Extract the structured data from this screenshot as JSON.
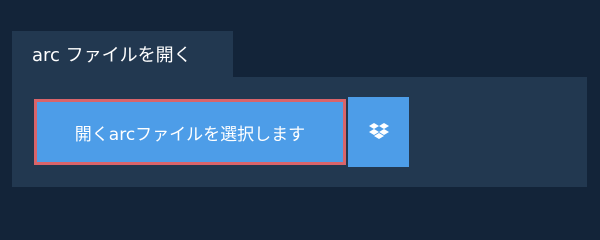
{
  "tab": {
    "label": "arc ファイルを開く"
  },
  "open_button": {
    "label": "開くarcファイルを選択します"
  },
  "dropbox_button": {
    "icon": "dropbox-icon"
  },
  "colors": {
    "background": "#132439",
    "panel": "#223850",
    "button": "#4d9de8",
    "highlight_border": "#d9646a"
  }
}
